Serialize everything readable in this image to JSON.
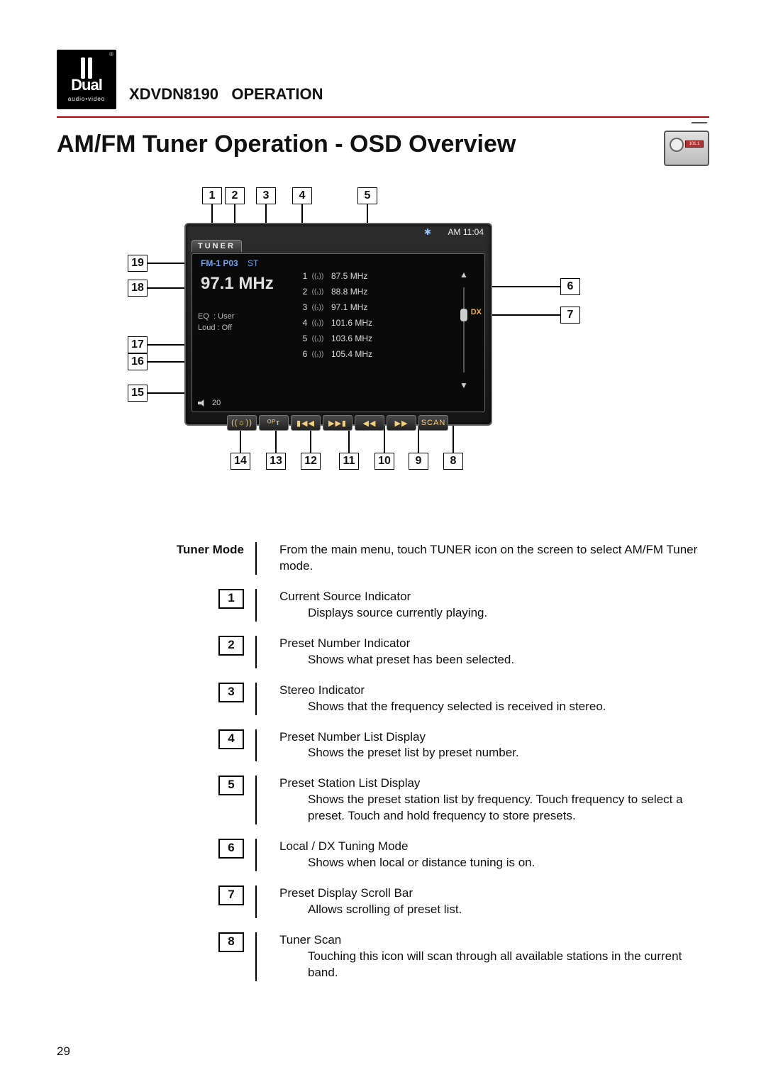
{
  "header": {
    "logo_main": "Dual",
    "logo_sub": "audio•video",
    "model": "XDVDN8190",
    "operation_word": "OPERATION"
  },
  "title": "AM/FM Tuner Operation - OSD Overview",
  "radio_icon_text": "101.1",
  "device": {
    "source_tab": "TUNER",
    "bluetooth_glyph": "✱",
    "clock_band": "AM",
    "clock_time": "11:04",
    "band_preset": "FM-1 P03",
    "stereo": "ST",
    "frequency": "97.1  MHz",
    "eq_label": "EQ",
    "eq_value": ": User",
    "loud_label": "Loud",
    "loud_value": ": Off",
    "volume": "20",
    "dx_label": "DX",
    "presets": [
      {
        "n": "1",
        "sig": "((₁))",
        "f": "87.5 MHz"
      },
      {
        "n": "2",
        "sig": "((₁))",
        "f": "88.8 MHz"
      },
      {
        "n": "3",
        "sig": "((₁))",
        "f": "97.1 MHz"
      },
      {
        "n": "4",
        "sig": "((₁))",
        "f": "101.6 MHz"
      },
      {
        "n": "5",
        "sig": "((₁))",
        "f": "103.6 MHz"
      },
      {
        "n": "6",
        "sig": "((₁))",
        "f": "105.4 MHz"
      }
    ],
    "buttons": [
      "((☼))",
      "ᴼᴾᴛ",
      "▮◀◀",
      "▶▶▮",
      "◀◀",
      "▶▶",
      "SCAN"
    ]
  },
  "callouts": {
    "top": [
      "1",
      "2",
      "3",
      "4",
      "5"
    ],
    "left": {
      "19": "19",
      "18": "18",
      "17": "17",
      "16": "16",
      "15": "15"
    },
    "right": {
      "6": "6",
      "7": "7"
    },
    "bottom": [
      "14",
      "13",
      "12",
      "11",
      "10",
      "9",
      "8"
    ]
  },
  "desc_heading": "Tuner Mode",
  "desc_heading_body": "From the main menu, touch TUNER icon on the screen to select AM/FM Tuner mode.",
  "items": [
    {
      "n": "1",
      "t": "Current Source Indicator",
      "b": "Displays source currently playing."
    },
    {
      "n": "2",
      "t": "Preset Number Indicator",
      "b": "Shows what preset has been selected."
    },
    {
      "n": "3",
      "t": "Stereo Indicator",
      "b": "Shows that the frequency selected is received in stereo."
    },
    {
      "n": "4",
      "t": "Preset Number List Display",
      "b": "Shows the preset list by preset number."
    },
    {
      "n": "5",
      "t": "Preset Station List Display",
      "b": "Shows the preset station list by frequency. Touch frequency to select a preset. Touch and hold frequency to store presets."
    },
    {
      "n": "6",
      "t": "Local / DX Tuning Mode",
      "b": "Shows when local or distance tuning is on."
    },
    {
      "n": "7",
      "t": "Preset Display Scroll Bar",
      "b": "Allows scrolling of preset list."
    },
    {
      "n": "8",
      "t": "Tuner Scan",
      "b": "Touching this icon will scan through all available stations in the current band."
    }
  ],
  "page_number": "29"
}
